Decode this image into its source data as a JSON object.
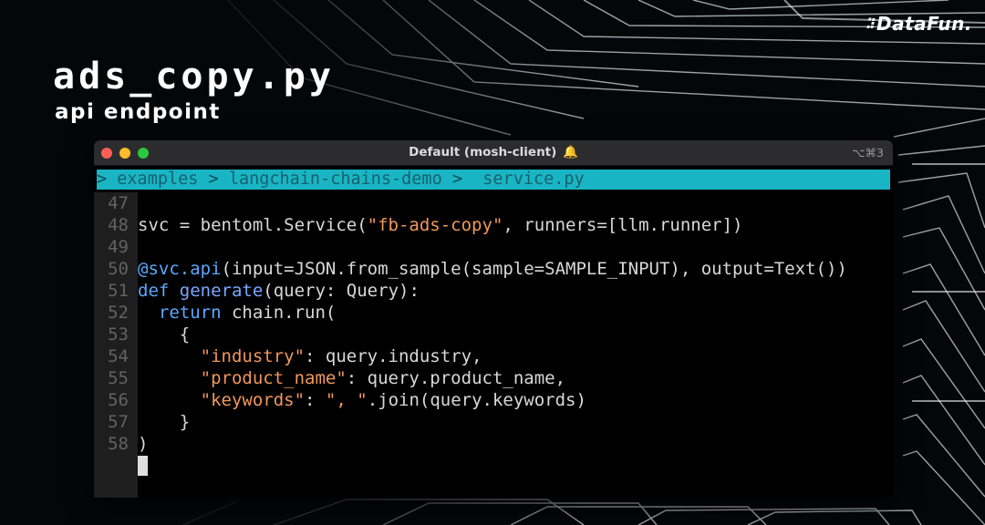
{
  "slide": {
    "title": "ads_copy.py",
    "subtitle": "api endpoint",
    "logo": "DataFun."
  },
  "window": {
    "title": "Default (mosh-client)",
    "bell_icon": "🔔",
    "shortcut": "⌥⌘3"
  },
  "breadcrumb": {
    "items": [
      "examples",
      "langchain-chains-demo",
      "service.py"
    ]
  },
  "code": {
    "line_numbers": [
      "47",
      "48",
      "49",
      "50",
      "51",
      "52",
      "53",
      "54",
      "55",
      "56",
      "57",
      "58"
    ],
    "lines": [
      "",
      "svc = bentoml.Service(\"fb-ads-copy\", runners=[llm.runner])",
      "",
      "@svc.api(input=JSON.from_sample(sample=SAMPLE_INPUT), output=Text())",
      "def generate(query: Query):",
      "  return chain.run(",
      "    {",
      "      \"industry\": query.industry,",
      "      \"product_name\": query.product_name,",
      "      \"keywords\": \", \".join(query.keywords)",
      "    }",
      ")"
    ]
  },
  "colors": {
    "breadcrumb_bg": "#19b5c4",
    "keyword": "#5aa8ff",
    "string": "#f0975b",
    "traffic_close": "#fe5f57",
    "traffic_min": "#febc2e",
    "traffic_max": "#28c840"
  }
}
